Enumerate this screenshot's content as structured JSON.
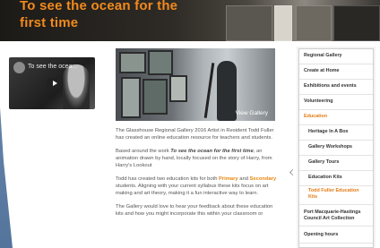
{
  "banner": {
    "title_line1": "To see the ocean for the",
    "title_line2": "first time"
  },
  "video": {
    "title": "To see the ocea..."
  },
  "gallery": {
    "view_label": "View Gallery"
  },
  "content": {
    "p1": "The Glasshouse Regional Gallery 2016 Artist in Resident Todd Fuller has created an online education resource for teachers and students.",
    "p2_prefix": "Based around the work ",
    "p2_title": "To see the ocean for the first time",
    "p2_suffix": ", an animation drawn by hand, locally focused on the story of Harry, from Harry's Lookout",
    "p3_a": "Todd has created two education kits for both ",
    "p3_primary": "Primary",
    "p3_b": " and ",
    "p3_secondary": "Secondary",
    "p3_c": " students.  Aligning with your current syllabus these kits focus on art making and art theory, making it a fun interactive way to learn.",
    "p4": "The Gallery would love to hear your feedback about these education kits and how you might incorporate this within your classroom or"
  },
  "sidebar": {
    "items": [
      {
        "label": "Regional Gallery"
      },
      {
        "label": "Create at Home"
      },
      {
        "label": "Exhibitions and events"
      },
      {
        "label": "Volunteering"
      },
      {
        "label": "Education"
      },
      {
        "label": "Heritage In A Box"
      },
      {
        "label": "Gallery Workshops"
      },
      {
        "label": "Gallery Tours"
      },
      {
        "label": "Education Kits"
      },
      {
        "label": "Todd Fuller Education Kits"
      },
      {
        "label": "Port Macquarie-Hastings Council Art Collection"
      },
      {
        "label": "Opening hours"
      }
    ]
  },
  "colors": {
    "accent": "#e8860f",
    "banner_title": "#f28a1c"
  }
}
